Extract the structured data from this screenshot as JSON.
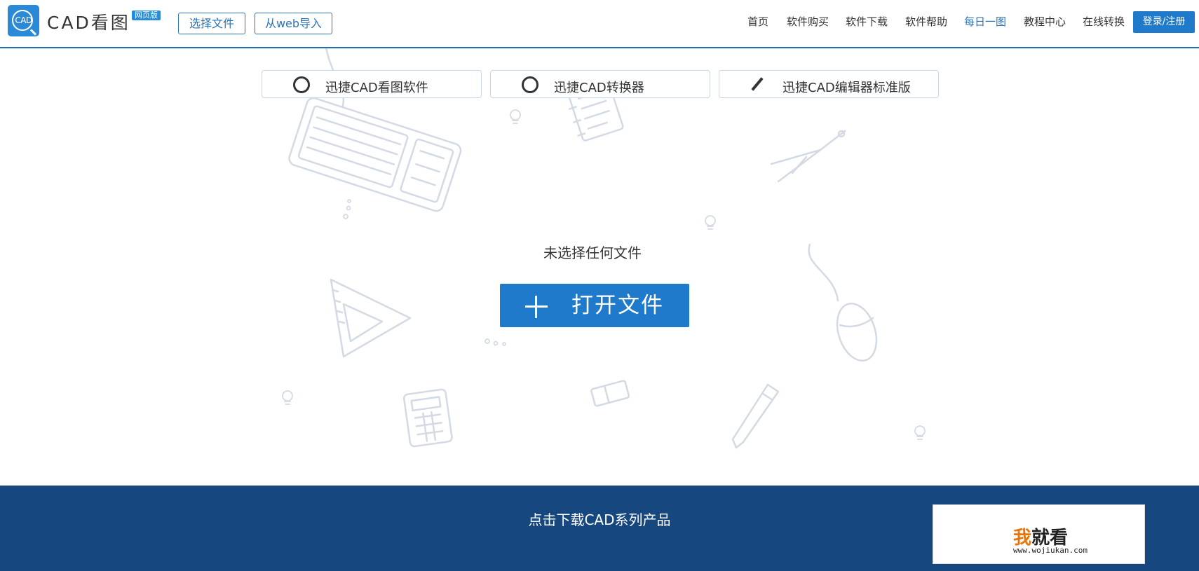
{
  "header": {
    "logo_icon_text": "CAD",
    "logo_text": "CAD看图",
    "badge": "网页版",
    "select_file": "选择文件",
    "import_web": "从web导入",
    "nav": [
      {
        "label": "首页",
        "active": false
      },
      {
        "label": "软件购买",
        "active": false
      },
      {
        "label": "软件下载",
        "active": false
      },
      {
        "label": "软件帮助",
        "active": false
      },
      {
        "label": "每日一图",
        "active": true
      },
      {
        "label": "教程中心",
        "active": false
      },
      {
        "label": "在线转换",
        "active": false
      }
    ],
    "login": "登录/注册"
  },
  "main": {
    "status": "未选择任何文件",
    "open_button": "打开文件"
  },
  "footer": {
    "title": "点击下载CAD系列产品",
    "products": [
      "迅捷CAD看图软件",
      "迅捷CAD转换器",
      "迅捷CAD编辑器标准版"
    ]
  },
  "watermark": {
    "char1": "我",
    "chars": "就看",
    "url": "www.wojiukan.com"
  },
  "colors": {
    "accent": "#1f7acb",
    "footer_bg": "#17477f",
    "doodle": "#d4dae3"
  }
}
